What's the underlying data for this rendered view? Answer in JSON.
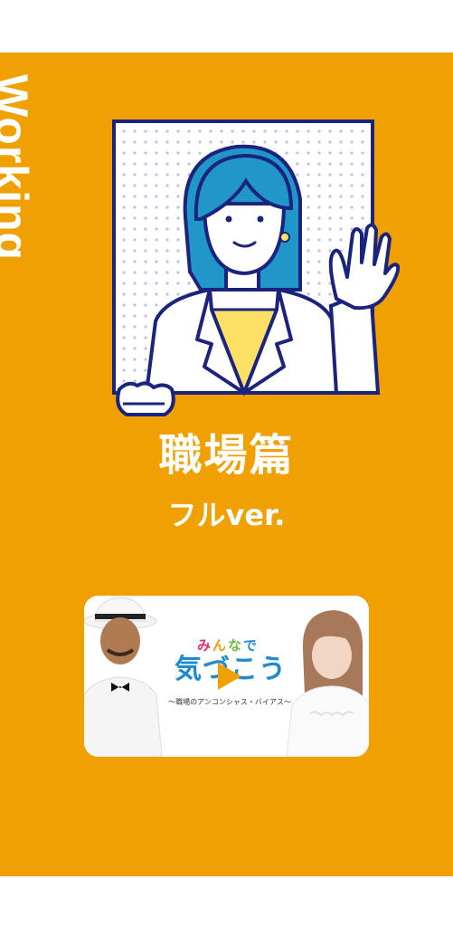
{
  "page": {
    "side_label": "Working",
    "title": "職場篇",
    "subtitle": "フルver."
  },
  "video": {
    "logo_top": [
      "み",
      "ん",
      "な",
      "で"
    ],
    "logo_main": "気づこう",
    "logo_sub": "〜職場のアンコンシャス・バイアス〜",
    "play_icon": "play-icon"
  },
  "colors": {
    "panel": "#f0a000",
    "navy": "#1a237e",
    "hair_blue": "#2196c8",
    "shirt_yellow": "#ffe066",
    "accent_blue": "#1e8ad0"
  }
}
